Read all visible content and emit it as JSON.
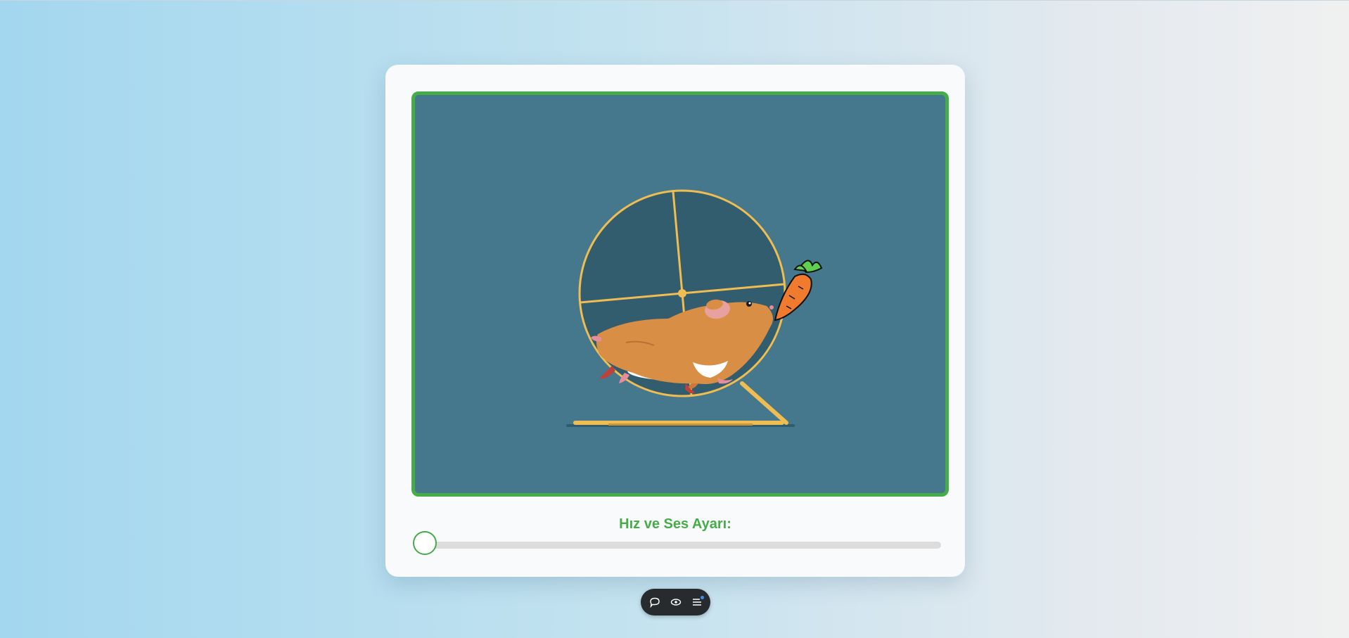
{
  "control": {
    "label": "Hız ve Ses Ayarı:",
    "speed_value_percent": 0
  },
  "colors": {
    "accent": "#45ac48",
    "stage_background": "#45788c",
    "wheel": "#efbd52",
    "hamster": "#d98e45",
    "carrot": "#f07b2e",
    "carrot_leaves": "#5fcf4e"
  },
  "scene": {
    "items": [
      "hamster-wheel",
      "hamster",
      "carrot",
      "wheel-stand"
    ]
  },
  "dock": {
    "icons": [
      "chat-bubble-icon",
      "eye-icon",
      "menu-icon"
    ]
  }
}
